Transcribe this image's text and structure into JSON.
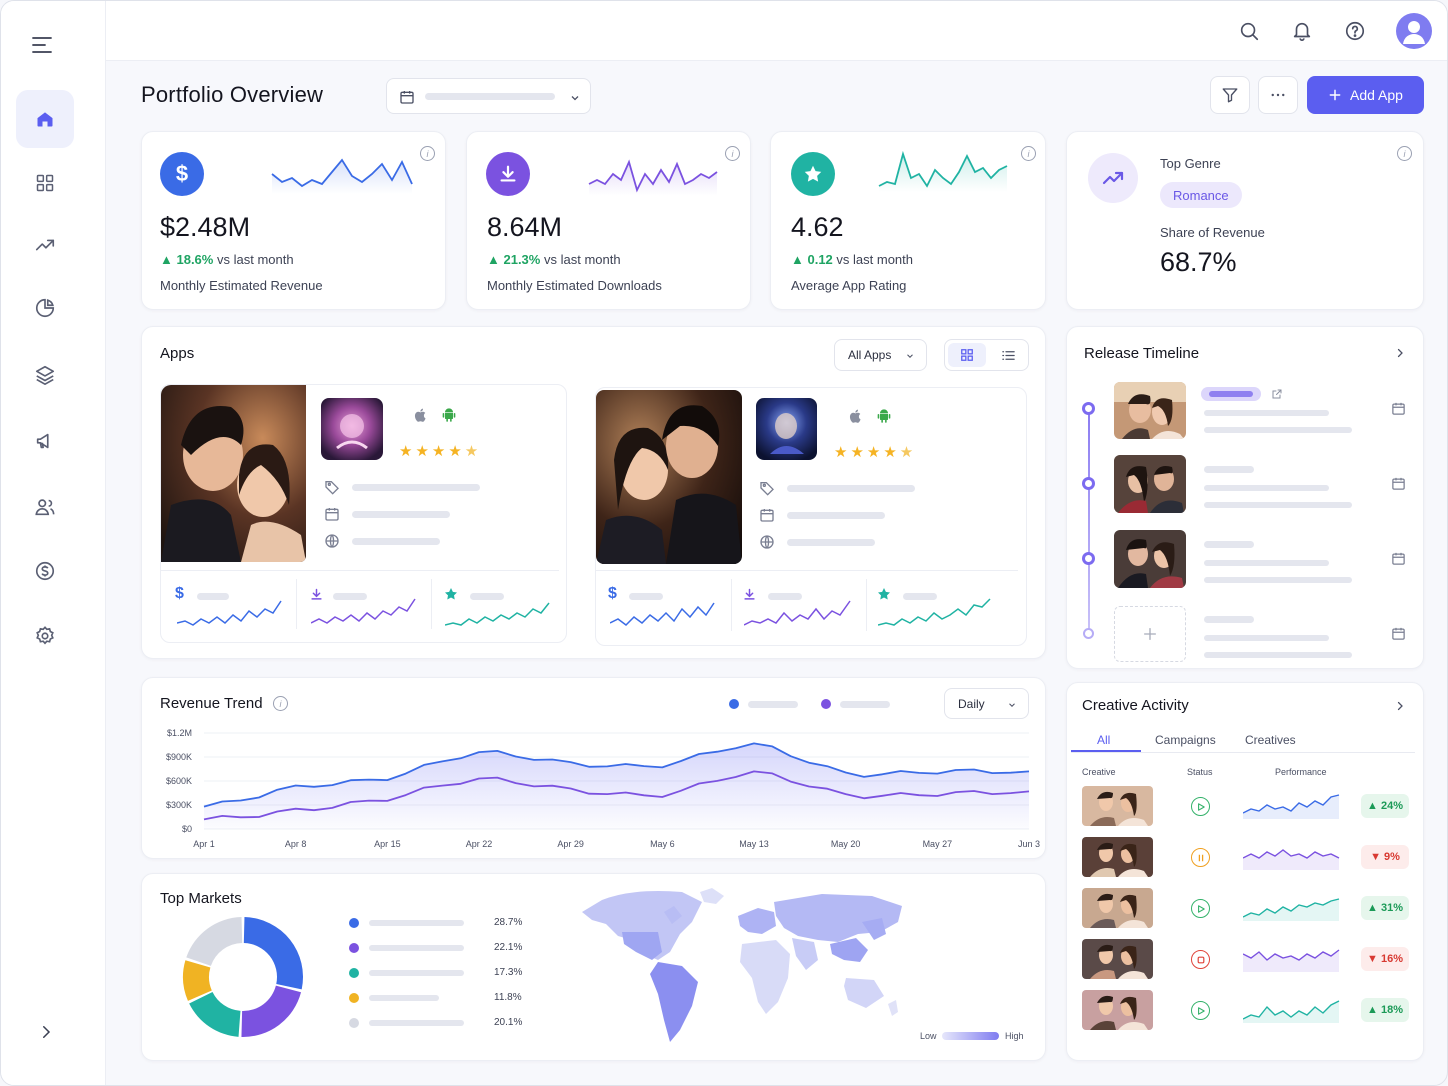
{
  "page": {
    "title": "Portfolio Overview"
  },
  "toolbar": {
    "add_app_label": "Add App"
  },
  "kpis": [
    {
      "value": "$2.48M",
      "delta": "18.6%",
      "delta_suffix": "vs last month",
      "label": "Monthly Estimated Revenue",
      "icon": "dollar-icon",
      "color": "#3a6be6"
    },
    {
      "value": "8.64M",
      "delta": "21.3%",
      "delta_suffix": "vs last month",
      "label": "Monthly Estimated Downloads",
      "icon": "download-icon",
      "color": "#7b52e0"
    },
    {
      "value": "4.62",
      "delta": "0.12",
      "delta_suffix": "vs last month",
      "label": "Average App Rating",
      "icon": "star-icon",
      "color": "#20b3a3"
    }
  ],
  "genre": {
    "label": "Top Genre",
    "value": "Romance",
    "share_label": "Share of Revenue",
    "share_value": "68.7%"
  },
  "apps": {
    "title": "Apps",
    "filter": "All Apps"
  },
  "timeline": {
    "title": "Release Timeline"
  },
  "revenue": {
    "title": "Revenue Trend",
    "period": "Daily",
    "y_ticks": [
      "$1.2M",
      "$900K",
      "$600K",
      "$300K",
      "$0"
    ],
    "x_ticks": [
      "Apr 1",
      "Apr 8",
      "Apr 15",
      "Apr 22",
      "Apr 29",
      "May 6",
      "May 13",
      "May 20",
      "May 27",
      "Jun 3"
    ]
  },
  "chart_data": {
    "type": "area",
    "title": "Revenue Trend",
    "x": [
      "Apr 1",
      "Apr 8",
      "Apr 15",
      "Apr 22",
      "Apr 29",
      "May 6",
      "May 13",
      "May 20",
      "May 27",
      "Jun 3"
    ],
    "ylim": [
      0,
      1200000
    ],
    "series": [
      {
        "values": [
          280000,
          520000,
          640000,
          950000,
          820000,
          800000,
          1050000,
          700000,
          720000,
          720000
        ]
      },
      {
        "values": [
          120000,
          230000,
          380000,
          620000,
          490000,
          430000,
          700000,
          430000,
          440000,
          470000
        ]
      }
    ]
  },
  "markets": {
    "title": "Top Markets",
    "items": [
      {
        "pct": "28.7%",
        "color": "#3a6be6"
      },
      {
        "pct": "22.1%",
        "color": "#7b52e0"
      },
      {
        "pct": "17.3%",
        "color": "#20b3a3"
      },
      {
        "pct": "11.8%",
        "color": "#f0b323"
      },
      {
        "pct": "20.1%",
        "color": "#d6d9e2"
      }
    ],
    "legend_low": "Low",
    "legend_high": "High"
  },
  "creative": {
    "title": "Creative Activity",
    "tabs": [
      "All",
      "Campaigns",
      "Creatives"
    ],
    "cols": [
      "Creative",
      "Status",
      "Performance"
    ],
    "rows": [
      {
        "status": "play",
        "delta": "24%",
        "dir": "up"
      },
      {
        "status": "pause",
        "delta": "9%",
        "dir": "down"
      },
      {
        "status": "play",
        "delta": "31%",
        "dir": "up"
      },
      {
        "status": "stop",
        "delta": "16%",
        "dir": "down"
      },
      {
        "status": "play",
        "delta": "18%",
        "dir": "up"
      }
    ]
  }
}
